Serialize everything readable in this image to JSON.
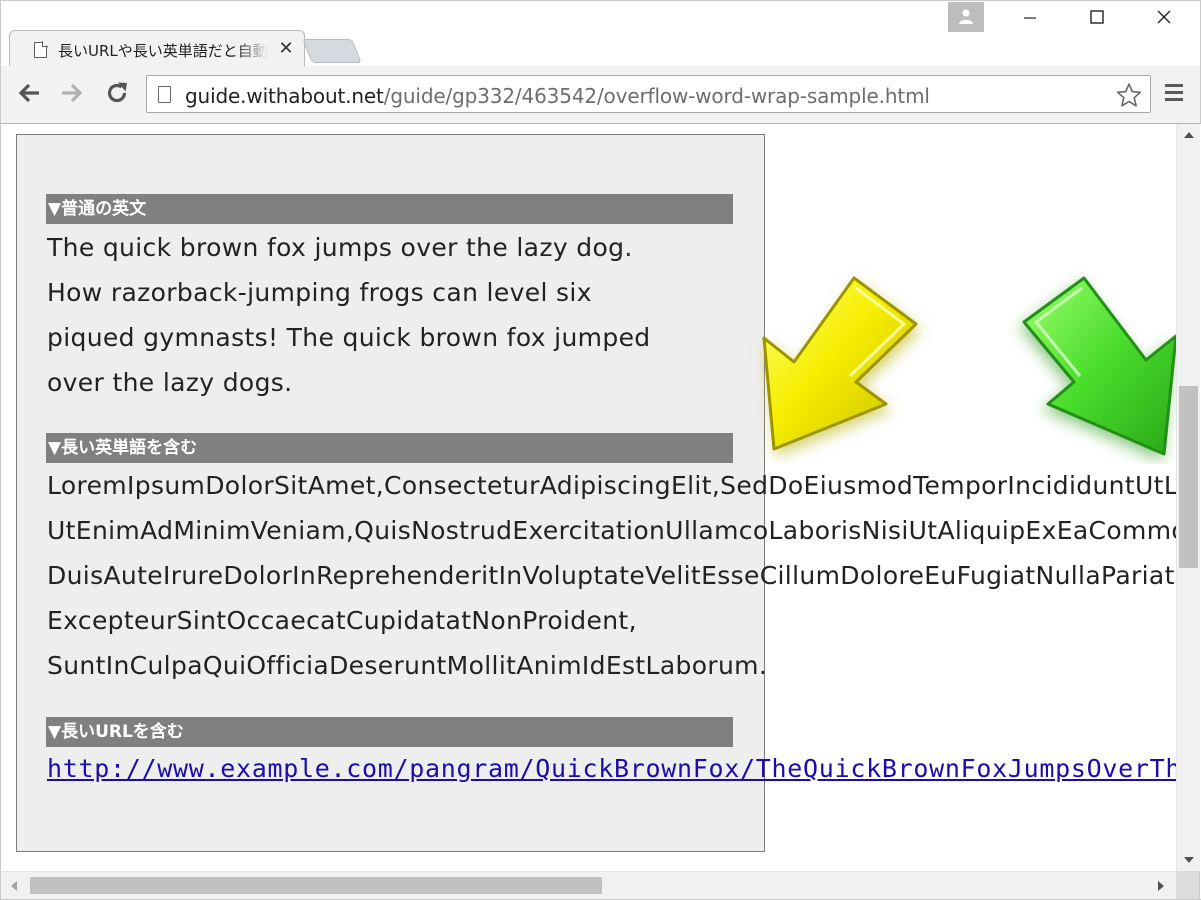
{
  "browser": {
    "tab": {
      "title": "長いURLや長い英単語だと自動改行されない場合の対策",
      "close_glyph": "✕"
    },
    "address_bar": {
      "host": "guide.withabout.net",
      "path": "/guide/gp332/463542/overflow-word-wrap-sample.html"
    }
  },
  "page": {
    "sections": [
      {
        "heading": "▼普通の英文",
        "lines": [
          "The quick brown fox jumps over the lazy dog.",
          "How razorback-jumping frogs can level six",
          "piqued gymnasts! The quick brown fox jumped",
          "over the lazy dogs."
        ]
      },
      {
        "heading": "▼長い英単語を含む",
        "lines": [
          "LoremIpsumDolorSitAmet,ConsecteturAdipiscingElit,SedDoEiusmodTemporIncididuntUtLaboreEtDoloreMagnaAliqua.",
          "UtEnimAdMinimVeniam,QuisNostrudExercitationUllamcoLaborisNisiUtAliquipExEaCommodoConsequat.",
          "DuisAuteIrureDolorInReprehenderitInVoluptateVelitEsseCillumDoloreEuFugiatNullaPariatur.",
          "ExcepteurSintOccaecatCupidatatNonProident,",
          "SuntInCulpaQuiOfficiaDeseruntMollitAnimIdEstLaborum."
        ]
      },
      {
        "heading": "▼長いURLを含む",
        "link": "http://www.example.com/pangram/QuickBrownFox/TheQuickBrownFoxJumpsOverTheLazyDog.html"
      }
    ],
    "colors": {
      "box_background": "#eeeeee",
      "heading_background": "#808080",
      "link": "#1a0dab",
      "arrow_yellow": "#f5ea00",
      "arrow_green": "#3ed12a"
    }
  }
}
